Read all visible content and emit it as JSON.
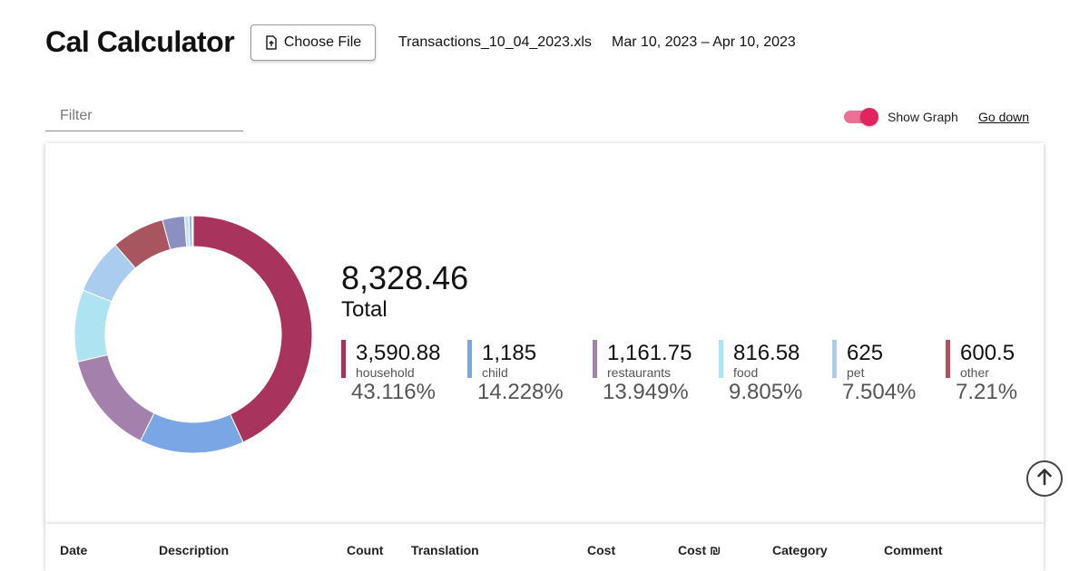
{
  "header": {
    "title": "Cal Calculator",
    "choose_file_label": "Choose File",
    "file_name": "Transactions_10_04_2023.xls",
    "date_range": "Mar 10, 2023 – Apr 10, 2023"
  },
  "controls": {
    "filter_placeholder": "Filter",
    "filter_value": "",
    "show_graph_label": "Show Graph",
    "show_graph_on": true,
    "go_down_label": "Go down"
  },
  "colors": {
    "accent": "#e0245e",
    "accent_track": "#ec6f96"
  },
  "summary": {
    "total_value": "8,328.46",
    "total_label": "Total",
    "categories": [
      {
        "value": "3,590.88",
        "name": "household",
        "percent": "43.116%",
        "color": "#a8335c"
      },
      {
        "value": "1,185",
        "name": "child",
        "percent": "14.228%",
        "color": "#7aa6e6"
      },
      {
        "value": "1,161.75",
        "name": "restaurants",
        "percent": "13.949%",
        "color": "#a481ad"
      },
      {
        "value": "816.58",
        "name": "food",
        "percent": "9.805%",
        "color": "#aee3f2"
      },
      {
        "value": "625",
        "name": "pet",
        "percent": "7.504%",
        "color": "#a9ccef"
      },
      {
        "value": "600.5",
        "name": "other",
        "percent": "7.21%",
        "color": "#a8555f"
      }
    ]
  },
  "chart_data": {
    "type": "pie",
    "title": "",
    "categories": [
      "household",
      "child",
      "restaurants",
      "food",
      "pet",
      "other",
      "unlabeled-1",
      "unlabeled-2",
      "unlabeled-3",
      "unlabeled-4"
    ],
    "values": [
      3590.88,
      1185,
      1161.75,
      816.58,
      625,
      600.5,
      250,
      50,
      35,
      14.25
    ],
    "colors": [
      "#a8335c",
      "#7aa6e6",
      "#a481ad",
      "#aee3f2",
      "#a9ccef",
      "#a8555f",
      "#8a90c2",
      "#c9dff5",
      "#8fb7e8",
      "#d3e3f3"
    ],
    "donut": true
  },
  "table": {
    "columns": [
      "Date",
      "Description",
      "Count",
      "Translation",
      "Cost",
      "Cost ₪",
      "Category",
      "Comment"
    ]
  },
  "icons": {
    "choose_file": "file-upload-icon",
    "scroll_up": "arrow-up-circle-icon"
  }
}
